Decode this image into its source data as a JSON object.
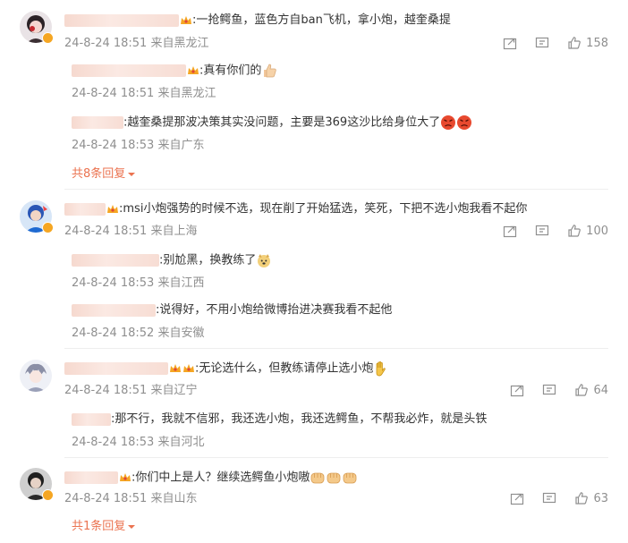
{
  "colors": {
    "accent": "#eb7350",
    "meta": "#8f8f8f",
    "text": "#333333"
  },
  "comments": [
    {
      "text": ":一抢鳄鱼，蓝色方自ban飞机，拿小炮，越奎桑提",
      "time": "24-8-24 18:51 来自黑龙江",
      "likes": "158",
      "replies": [
        {
          "text": ":真有你们的",
          "time": "24-8-24 18:51 来自黑龙江"
        },
        {
          "text": ":越奎桑提那波决策其实没问题，主要是369这沙比给身位大了",
          "time": "24-8-24 18:53 来自广东"
        }
      ],
      "more": "共8条回复"
    },
    {
      "text": ":msi小炮强势的时候不选，现在削了开始猛选，笑死，下把不选小炮我看不起你",
      "time": "24-8-24 18:51 来自上海",
      "likes": "100",
      "replies": [
        {
          "text": ":别尬黑，换教练了",
          "time": "24-8-24 18:53 来自江西"
        },
        {
          "text": ":说得好，不用小炮给微博抬进决赛我看不起他",
          "time": "24-8-24 18:52 来自安徽"
        }
      ]
    },
    {
      "text": ":无论选什么，但教练请停止选小炮",
      "time": "24-8-24 18:51 来自辽宁",
      "likes": "64",
      "replies": [
        {
          "text": ":那不行，我就不信邪，我还选小炮，我还选鳄鱼，不帮我必炸，就是头铁",
          "time": "24-8-24 18:53 来自河北"
        }
      ]
    },
    {
      "text": ":你们中上是人？继续选鳄鱼小炮嗷",
      "time": "24-8-24 18:51 来自山东",
      "likes": "63",
      "replies": [],
      "more": "共1条回复"
    }
  ],
  "icons": {
    "share": "share-icon",
    "comment": "comment-icon",
    "like": "thumb-up-icon",
    "more_arrow": "caret-down-icon"
  }
}
